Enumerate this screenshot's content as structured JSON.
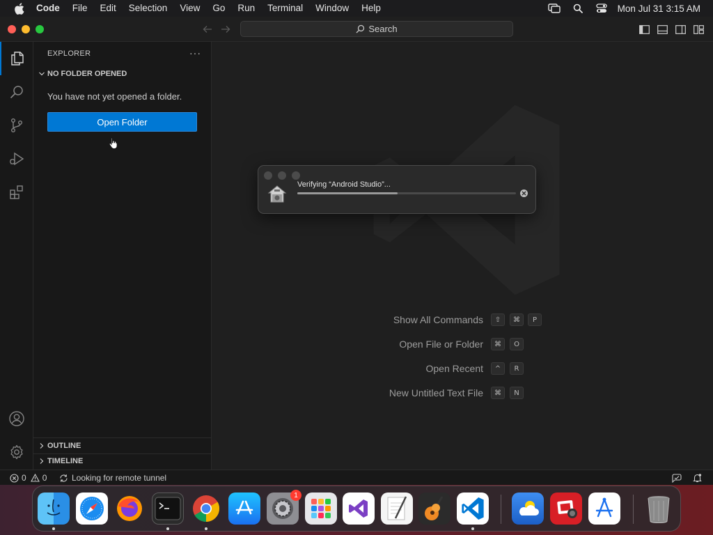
{
  "menubar": {
    "app_name": "Code",
    "items": [
      "File",
      "Edit",
      "Selection",
      "View",
      "Go",
      "Run",
      "Terminal",
      "Window",
      "Help"
    ],
    "clock": "Mon Jul 31  3:15 AM"
  },
  "titlebar": {
    "search_label": "Search"
  },
  "sidebar": {
    "title": "EXPLORER",
    "more": "···",
    "section_title": "NO FOLDER OPENED",
    "message": "You have not yet opened a folder.",
    "open_folder_label": "Open Folder",
    "outline_label": "OUTLINE",
    "timeline_label": "TIMELINE"
  },
  "editor": {
    "commands": [
      {
        "label": "Show All Commands",
        "keys": [
          "⇧",
          "⌘",
          "P"
        ]
      },
      {
        "label": "Open File or Folder",
        "keys": [
          "⌘",
          "O"
        ]
      },
      {
        "label": "Open Recent",
        "keys": [
          "^",
          "R"
        ]
      },
      {
        "label": "New Untitled Text File",
        "keys": [
          "⌘",
          "N"
        ]
      }
    ]
  },
  "dialog": {
    "title": "Verifying “Android Studio”...",
    "progress": 0.46
  },
  "statusbar": {
    "errors": "0",
    "warnings": "0",
    "remote_status": "Looking for remote tunnel"
  },
  "dock": {
    "apps": [
      {
        "name": "Finder",
        "running": true
      },
      {
        "name": "Safari",
        "running": false
      },
      {
        "name": "Firefox",
        "running": false
      },
      {
        "name": "Terminal",
        "running": true
      },
      {
        "name": "Chrome",
        "running": true
      },
      {
        "name": "App Store",
        "running": false
      },
      {
        "name": "System Settings",
        "running": false,
        "badge": "1"
      },
      {
        "name": "Launchpad",
        "running": false
      },
      {
        "name": "Visual Studio",
        "running": false
      },
      {
        "name": "TextEdit",
        "running": false
      },
      {
        "name": "GarageBand",
        "running": false
      },
      {
        "name": "Visual Studio Code",
        "running": true
      },
      {
        "name": "Weather",
        "running": false
      },
      {
        "name": "Photo Booth",
        "running": false
      },
      {
        "name": "Xcode Instruments",
        "running": false
      },
      {
        "name": "Trash",
        "running": false
      }
    ]
  },
  "colors": {
    "accent": "#0078d4",
    "background": "#1f1f1f",
    "sidebar": "#181818"
  }
}
